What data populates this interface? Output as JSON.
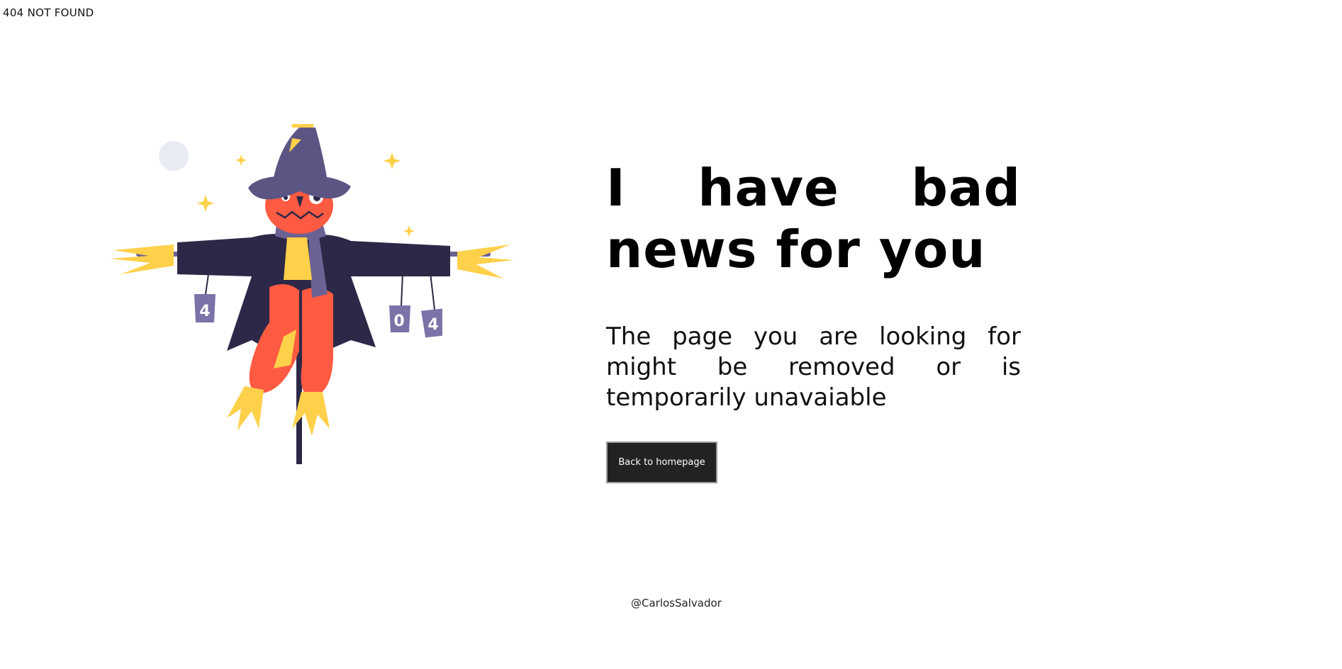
{
  "topbar": {
    "title": "404 NOT FOUND"
  },
  "main": {
    "headline": "I have bad news for you",
    "description": "The page you are looking for might be removed or is temporarily unavaiable",
    "cta_label": "Back to homepage"
  },
  "illustration": {
    "can_labels": [
      "4",
      "0",
      "4"
    ],
    "colors": {
      "hat": "#5b5584",
      "face": "#ff5a42",
      "coat": "#2d2847",
      "straw": "#ffd04a",
      "scarf": "#6b6294",
      "moon": "#e8ebf4",
      "pole": "#2d2847"
    }
  },
  "footer": {
    "credit": "@CarlosSalvador"
  }
}
